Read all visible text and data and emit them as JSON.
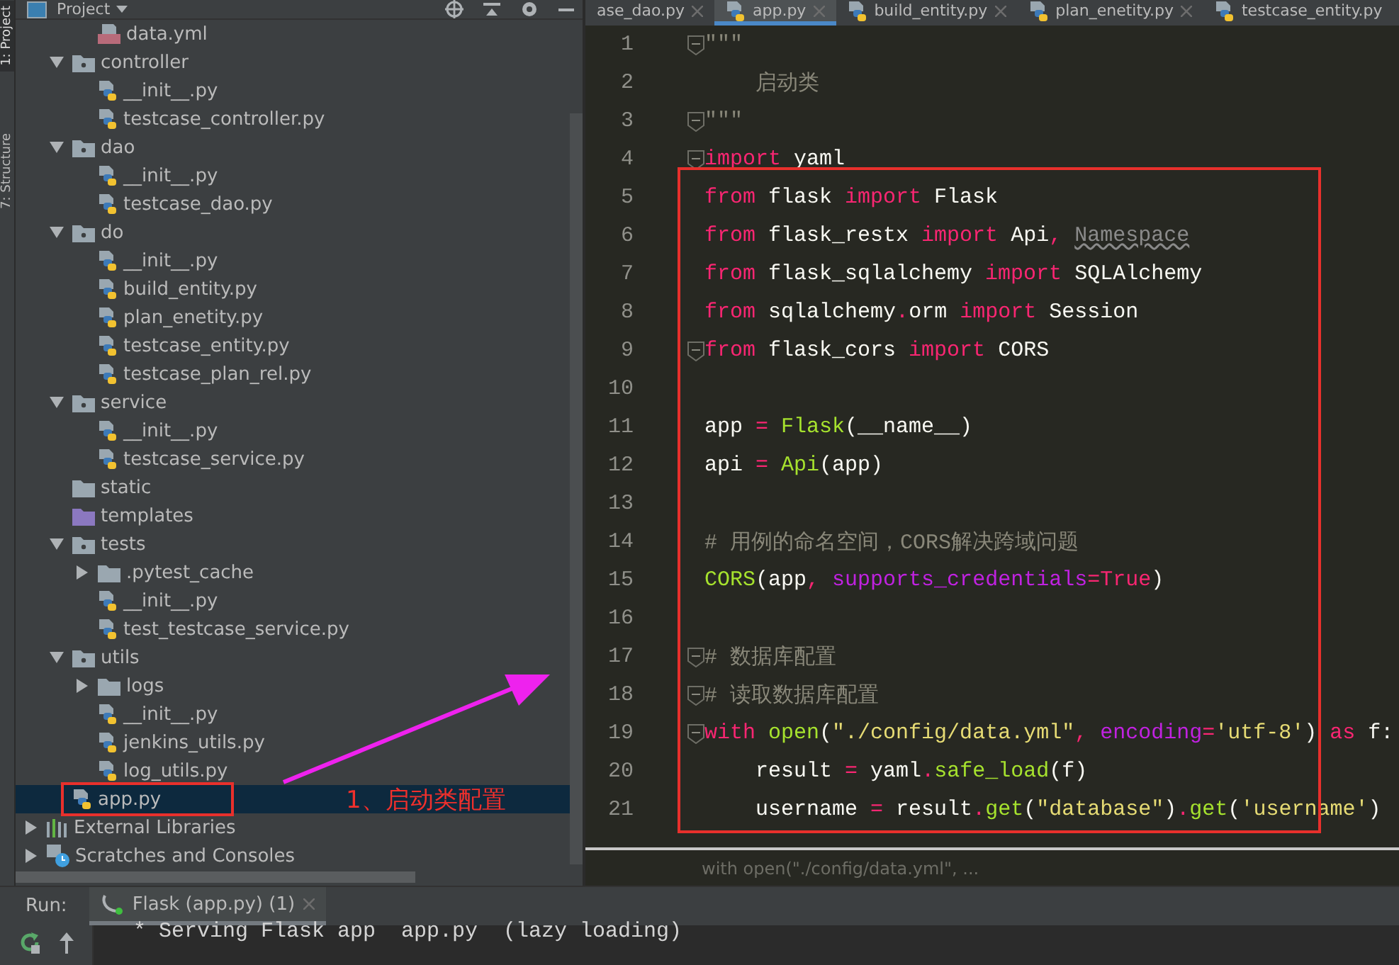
{
  "tool_strip": [
    {
      "label": "1: Project",
      "selected": true
    },
    {
      "label": "7: Structure",
      "selected": false
    }
  ],
  "project_panel": {
    "title": "Project",
    "tree": [
      {
        "kind": "hidden",
        "children": [
          {
            "kind": "hidden",
            "children": [
              {
                "kind": "yml",
                "name": "data.yml",
                "selected": false
              }
            ]
          },
          {
            "kind": "package",
            "name": "controller",
            "expanded": true,
            "selected": false,
            "children": [
              {
                "kind": "py",
                "name": "__init__.py",
                "selected": false
              },
              {
                "kind": "py",
                "name": "testcase_controller.py",
                "selected": false
              }
            ]
          },
          {
            "kind": "package",
            "name": "dao",
            "expanded": true,
            "selected": false,
            "children": [
              {
                "kind": "py",
                "name": "__init__.py",
                "selected": false
              },
              {
                "kind": "py",
                "name": "testcase_dao.py",
                "selected": false
              }
            ]
          },
          {
            "kind": "package",
            "name": "do",
            "expanded": true,
            "selected": false,
            "children": [
              {
                "kind": "py",
                "name": "__init__.py",
                "selected": false
              },
              {
                "kind": "py",
                "name": "build_entity.py",
                "selected": false
              },
              {
                "kind": "py",
                "name": "plan_enetity.py",
                "selected": false
              },
              {
                "kind": "py",
                "name": "testcase_entity.py",
                "selected": false
              },
              {
                "kind": "py",
                "name": "testcase_plan_rel.py",
                "selected": false
              }
            ]
          },
          {
            "kind": "package",
            "name": "service",
            "expanded": true,
            "selected": false,
            "children": [
              {
                "kind": "py",
                "name": "__init__.py",
                "selected": false
              },
              {
                "kind": "py",
                "name": "testcase_service.py",
                "selected": false
              }
            ]
          },
          {
            "kind": "folder",
            "name": "static",
            "selected": false
          },
          {
            "kind": "templates",
            "name": "templates",
            "selected": false
          },
          {
            "kind": "package",
            "name": "tests",
            "expanded": true,
            "selected": false,
            "children": [
              {
                "kind": "folder",
                "name": ".pytest_cache",
                "expanded": false,
                "selected": false
              },
              {
                "kind": "py",
                "name": "__init__.py",
                "selected": false
              },
              {
                "kind": "py",
                "name": "test_testcase_service.py",
                "selected": false
              }
            ]
          },
          {
            "kind": "package",
            "name": "utils",
            "expanded": true,
            "selected": false,
            "children": [
              {
                "kind": "folder",
                "name": "logs",
                "expanded": false,
                "selected": false
              },
              {
                "kind": "py",
                "name": "__init__.py",
                "selected": false
              },
              {
                "kind": "py",
                "name": "jenkins_utils.py",
                "selected": false
              },
              {
                "kind": "py",
                "name": "log_utils.py",
                "selected": false
              }
            ]
          },
          {
            "kind": "py",
            "name": "app.py",
            "selected": true
          }
        ]
      },
      {
        "kind": "libraries",
        "name": "External Libraries",
        "expanded": false,
        "selected": false
      },
      {
        "kind": "scratches",
        "name": "Scratches and Consoles",
        "expanded": false,
        "selected": false
      }
    ]
  },
  "editor": {
    "tabs": [
      {
        "label": "ase_dao.py",
        "selected": false
      },
      {
        "label": "app.py",
        "selected": true
      },
      {
        "label": "build_entity.py",
        "selected": false
      },
      {
        "label": "plan_enetity.py",
        "selected": false
      },
      {
        "label": "testcase_entity.py",
        "selected": false
      }
    ],
    "lines": [
      {
        "number": "1",
        "fold": true,
        "tokens": [
          {
            "kind": "doc",
            "text": "\"\"\""
          }
        ]
      },
      {
        "number": "2",
        "fold": false,
        "tokens": [
          {
            "kind": "doc",
            "text": "    启动类"
          }
        ]
      },
      {
        "number": "3",
        "fold": true,
        "tokens": [
          {
            "kind": "doc",
            "text": "\"\"\""
          }
        ]
      },
      {
        "number": "4",
        "fold": true,
        "tokens": [
          {
            "kind": "kw",
            "text": "import"
          },
          {
            "kind": "plain",
            "text": " yaml"
          }
        ]
      },
      {
        "number": "5",
        "fold": false,
        "tokens": [
          {
            "kind": "kw",
            "text": "from"
          },
          {
            "kind": "plain",
            "text": " flask "
          },
          {
            "kind": "kw",
            "text": "import"
          },
          {
            "kind": "plain",
            "text": " Flask"
          }
        ]
      },
      {
        "number": "6",
        "fold": false,
        "tokens": [
          {
            "kind": "kw",
            "text": "from"
          },
          {
            "kind": "plain",
            "text": " flask_restx "
          },
          {
            "kind": "kw",
            "text": "import"
          },
          {
            "kind": "plain",
            "text": " Api"
          },
          {
            "kind": "op",
            "text": ", "
          },
          {
            "kind": "unused",
            "text": "Namespace"
          }
        ]
      },
      {
        "number": "7",
        "fold": false,
        "tokens": [
          {
            "kind": "kw",
            "text": "from"
          },
          {
            "kind": "plain",
            "text": " flask_sqlalchemy "
          },
          {
            "kind": "kw",
            "text": "import"
          },
          {
            "kind": "plain",
            "text": " SQLAlchemy"
          }
        ]
      },
      {
        "number": "8",
        "fold": false,
        "tokens": [
          {
            "kind": "kw",
            "text": "from"
          },
          {
            "kind": "plain",
            "text": " sqlalchemy"
          },
          {
            "kind": "op",
            "text": "."
          },
          {
            "kind": "plain",
            "text": "orm "
          },
          {
            "kind": "kw",
            "text": "import"
          },
          {
            "kind": "plain",
            "text": " Session"
          }
        ]
      },
      {
        "number": "9",
        "fold": true,
        "tokens": [
          {
            "kind": "kw",
            "text": "from"
          },
          {
            "kind": "plain",
            "text": " flask_cors "
          },
          {
            "kind": "kw",
            "text": "import"
          },
          {
            "kind": "plain",
            "text": " CORS"
          }
        ]
      },
      {
        "number": "10",
        "fold": false
      },
      {
        "number": "11",
        "fold": false,
        "tokens": [
          {
            "kind": "plain",
            "text": "app "
          },
          {
            "kind": "op",
            "text": "= "
          },
          {
            "kind": "call",
            "text": "Flask"
          },
          {
            "kind": "plain",
            "text": "(__name__)"
          }
        ]
      },
      {
        "number": "12",
        "fold": false,
        "tokens": [
          {
            "kind": "plain",
            "text": "api "
          },
          {
            "kind": "op",
            "text": "= "
          },
          {
            "kind": "call",
            "text": "Api"
          },
          {
            "kind": "plain",
            "text": "(app)"
          }
        ]
      },
      {
        "number": "13",
        "fold": false
      },
      {
        "number": "14",
        "fold": false,
        "tokens": [
          {
            "kind": "comment",
            "text": "# 用例的命名空间，CORS解决跨域问题"
          }
        ]
      },
      {
        "number": "15",
        "fold": false,
        "tokens": [
          {
            "kind": "call",
            "text": "CORS"
          },
          {
            "kind": "plain",
            "text": "(app"
          },
          {
            "kind": "op",
            "text": ", "
          },
          {
            "kind": "param",
            "text": "supports_credentials"
          },
          {
            "kind": "op",
            "text": "="
          },
          {
            "kind": "kw",
            "text": "True"
          },
          {
            "kind": "plain",
            "text": ")"
          }
        ]
      },
      {
        "number": "16",
        "fold": false
      },
      {
        "number": "17",
        "fold": true,
        "tokens": [
          {
            "kind": "comment",
            "text": "# 数据库配置"
          }
        ]
      },
      {
        "number": "18",
        "fold": true,
        "tokens": [
          {
            "kind": "comment",
            "text": "# 读取数据库配置"
          }
        ]
      },
      {
        "number": "19",
        "fold": true,
        "tokens": [
          {
            "kind": "kw",
            "text": "with "
          },
          {
            "kind": "call",
            "text": "open"
          },
          {
            "kind": "plain",
            "text": "("
          },
          {
            "kind": "str",
            "text": "\"./config/data.yml\""
          },
          {
            "kind": "op",
            "text": ", "
          },
          {
            "kind": "param",
            "text": "encoding"
          },
          {
            "kind": "op",
            "text": "="
          },
          {
            "kind": "str",
            "text": "'utf-8'"
          },
          {
            "kind": "plain",
            "text": ") "
          },
          {
            "kind": "kw",
            "text": "as"
          },
          {
            "kind": "plain",
            "text": " f:"
          }
        ]
      },
      {
        "number": "20",
        "fold": false,
        "tokens": [
          {
            "kind": "plain",
            "text": "    result "
          },
          {
            "kind": "op",
            "text": "="
          },
          {
            "kind": "plain",
            "text": " yaml"
          },
          {
            "kind": "op",
            "text": "."
          },
          {
            "kind": "call",
            "text": "safe_load"
          },
          {
            "kind": "plain",
            "text": "(f)"
          }
        ]
      },
      {
        "number": "21",
        "fold": false,
        "tokens": [
          {
            "kind": "plain",
            "text": "    username "
          },
          {
            "kind": "op",
            "text": "="
          },
          {
            "kind": "plain",
            "text": " result"
          },
          {
            "kind": "op",
            "text": "."
          },
          {
            "kind": "call",
            "text": "get"
          },
          {
            "kind": "plain",
            "text": "("
          },
          {
            "kind": "str",
            "text": "\"database\""
          },
          {
            "kind": "plain",
            "text": ")"
          },
          {
            "kind": "op",
            "text": "."
          },
          {
            "kind": "call",
            "text": "get"
          },
          {
            "kind": "plain",
            "text": "("
          },
          {
            "kind": "str",
            "text": "'username'"
          },
          {
            "kind": "plain",
            "text": ")"
          }
        ]
      }
    ],
    "breadcrumb": "with open(\"./config/data.yml\", ..."
  },
  "run_panel": {
    "label": "Run:",
    "tabs": [
      {
        "label": "Flask (app.py) (1)",
        "selected": true
      }
    ],
    "console": [
      "* Serving Flask app  app.py  (lazy loading)"
    ]
  },
  "annotation": {
    "label": "1、启动类配置"
  }
}
